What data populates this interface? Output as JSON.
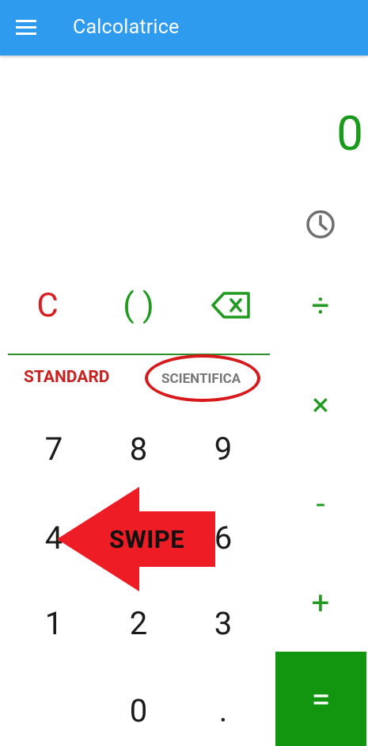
{
  "app": {
    "title": "Calcolatrice"
  },
  "display": {
    "value": "0"
  },
  "keys": {
    "clear": "C",
    "parens": "( )",
    "divide": "÷",
    "multiply": "×",
    "subtract": "-",
    "add": "+",
    "equals": "=",
    "digits": {
      "seven": "7",
      "eight": "8",
      "nine": "9",
      "four": "4",
      "six": "6",
      "one": "1",
      "two": "2",
      "three": "3",
      "zero": "0",
      "dot": "."
    }
  },
  "tabs": {
    "standard": "STANDARD",
    "scientific": "SCIENTIFICA"
  },
  "annotation": {
    "swipe_label": "SWIPE"
  },
  "icons": {
    "menu": "hamburger-menu-icon",
    "history": "clock-history-icon",
    "backspace": "backspace-icon"
  },
  "colors": {
    "appbar": "#2f9bef",
    "accent_green": "#1f9a1f",
    "clear_red": "#d81e1e",
    "equals_bg": "#12960f",
    "annotation_red": "#ee1c24"
  }
}
